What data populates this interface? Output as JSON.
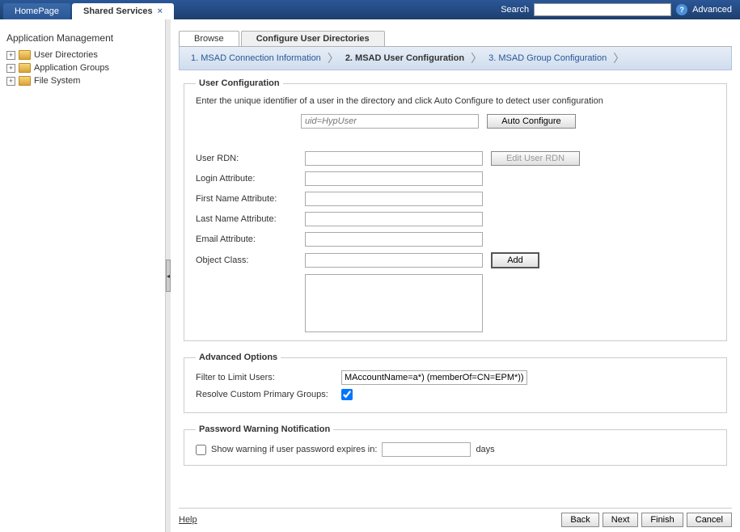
{
  "topbar": {
    "tabs": [
      {
        "label": "HomePage",
        "active": false
      },
      {
        "label": "Shared Services",
        "active": true
      }
    ],
    "search_label": "Search",
    "search_value": "",
    "advanced_label": "Advanced"
  },
  "sidebar": {
    "title": "Application Management",
    "items": [
      {
        "label": "User Directories"
      },
      {
        "label": "Application Groups"
      },
      {
        "label": "File System"
      }
    ]
  },
  "subtabs": {
    "browse": "Browse",
    "configure": "Configure User Directories"
  },
  "wizard": {
    "step1": "1. MSAD Connection Information",
    "step2": "2. MSAD User Configuration",
    "step3": "3. MSAD Group Configuration"
  },
  "user_config": {
    "legend": "User Configuration",
    "hint": "Enter the unique identifier of a user in the directory and click Auto Configure to detect user configuration",
    "uid_placeholder": "uid=HypUser",
    "auto_configure_btn": "Auto Configure",
    "rows": {
      "user_rdn": "User RDN:",
      "login_attr": "Login Attribute:",
      "first_name": "First Name Attribute:",
      "last_name": "Last Name Attribute:",
      "email": "Email Attribute:",
      "object_class": "Object Class:"
    },
    "edit_rdn_btn": "Edit User RDN",
    "add_btn": "Add"
  },
  "advanced": {
    "legend": "Advanced Options",
    "filter_label": "Filter to Limit Users:",
    "filter_value": "MAccountName=a*) (memberOf=CN=EPM*))",
    "resolve_label": "Resolve Custom Primary Groups:",
    "resolve_checked": true
  },
  "password_warning": {
    "legend": "Password Warning Notification",
    "show_label": "Show warning if user password expires in:",
    "days_label": "days"
  },
  "footer": {
    "help": "Help",
    "back": "Back",
    "next": "Next",
    "finish": "Finish",
    "cancel": "Cancel"
  }
}
